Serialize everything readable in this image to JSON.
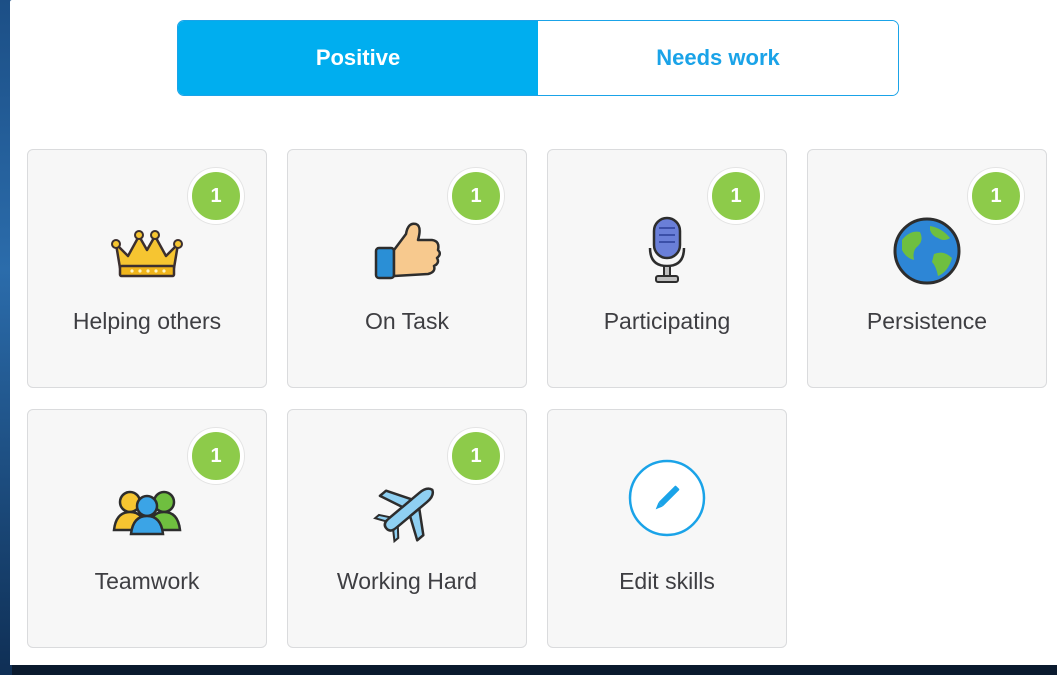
{
  "toggle": {
    "positive_label": "Positive",
    "needs_work_label": "Needs work"
  },
  "skills": [
    {
      "label": "Helping others",
      "count": "1",
      "icon": "crown-icon"
    },
    {
      "label": "On Task",
      "count": "1",
      "icon": "thumbs-up-icon"
    },
    {
      "label": "Participating",
      "count": "1",
      "icon": "microphone-icon"
    },
    {
      "label": "Persistence",
      "count": "1",
      "icon": "globe-icon"
    },
    {
      "label": "Teamwork",
      "count": "1",
      "icon": "team-icon"
    },
    {
      "label": "Working Hard",
      "count": "1",
      "icon": "airplane-icon"
    }
  ],
  "edit_skills": {
    "label": "Edit skills",
    "icon": "pencil-icon"
  },
  "colors": {
    "accent": "#00aeef",
    "badge": "#8dcb4a",
    "tile_bg": "#f7f7f7",
    "label_text": "#3e3e42"
  }
}
